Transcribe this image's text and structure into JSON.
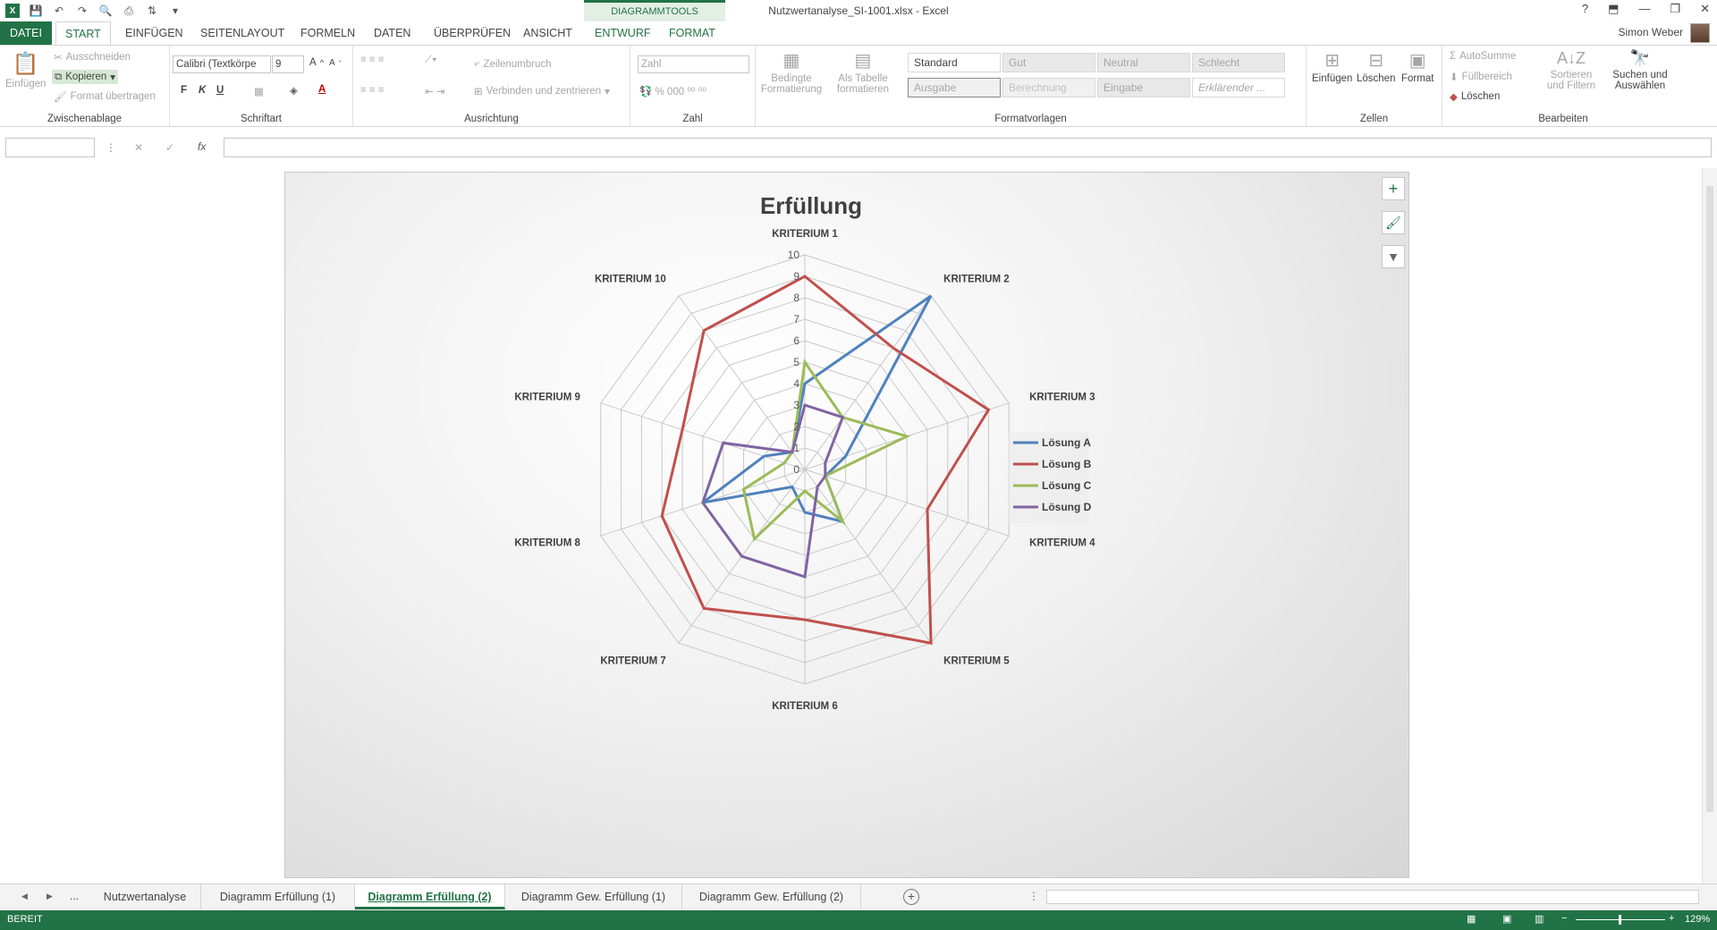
{
  "window": {
    "title": "Nutzwertanalyse_SI-1001.xlsx - Excel",
    "context_group": "DIAGRAMMTOOLS",
    "user": "Simon Weber",
    "help": "?",
    "min": "—",
    "restore": "❐",
    "close": "✕"
  },
  "tabs": {
    "datei": "DATEI",
    "start": "START",
    "einfuegen": "EINFÜGEN",
    "seitenlayout": "SEITENLAYOUT",
    "formeln": "FORMELN",
    "daten": "DATEN",
    "ueberpruefen": "ÜBERPRÜFEN",
    "ansicht": "ANSICHT",
    "entwurf": "ENTWURF",
    "format": "FORMAT"
  },
  "ribbon": {
    "clipboard": {
      "paste": "Einfügen",
      "cut": "Ausschneiden",
      "copy": "Kopieren",
      "format_painter": "Format übertragen",
      "label": "Zwischenablage"
    },
    "font": {
      "name": "Calibri (Textkörpe",
      "size": "9",
      "bold": "F",
      "italic": "K",
      "underline": "U",
      "label": "Schriftart"
    },
    "alignment": {
      "wrap": "Zeilenumbruch",
      "merge": "Verbinden und zentrieren",
      "label": "Ausrichtung"
    },
    "number": {
      "format": "Zahl",
      "label": "Zahl"
    },
    "styles": {
      "conditional": "Bedingte Formatierung",
      "as_table": "Als Tabelle formatieren",
      "cells": [
        "Standard",
        "Gut",
        "Neutral",
        "Schlecht",
        "Ausgabe",
        "Berechnung",
        "Eingabe",
        "Erklärender ..."
      ],
      "label": "Formatvorlagen"
    },
    "cells": {
      "insert": "Einfügen",
      "delete": "Löschen",
      "format": "Format",
      "label": "Zellen"
    },
    "editing": {
      "autosum": "AutoSumme",
      "fill": "Füllbereich",
      "clear": "Löschen",
      "sort": "Sortieren und Filtern",
      "find": "Suchen und Auswählen",
      "label": "Bearbeiten"
    }
  },
  "formula_bar": {
    "cancel": "✕",
    "enter": "✓",
    "fx": "fx",
    "value": ""
  },
  "chart_data": {
    "type": "radar",
    "title": "Erfüllung",
    "categories": [
      "KRITERIUM 1",
      "KRITERIUM 2",
      "KRITERIUM 3",
      "KRITERIUM 4",
      "KRITERIUM 5",
      "KRITERIUM 6",
      "KRITERIUM 7",
      "KRITERIUM 8",
      "KRITERIUM 9",
      "KRITERIUM 10"
    ],
    "rmax": 10,
    "ticks": [
      0,
      1,
      2,
      3,
      4,
      5,
      6,
      7,
      8,
      9,
      10
    ],
    "legend_position": "right",
    "series": [
      {
        "name": "Lösung A",
        "color": "#4f81bd",
        "values": [
          4,
          10,
          2,
          1,
          3,
          2,
          1,
          5,
          2,
          1
        ]
      },
      {
        "name": "Lösung B",
        "color": "#c0504d",
        "values": [
          9,
          7,
          9,
          6,
          10,
          7,
          8,
          7,
          6,
          8
        ]
      },
      {
        "name": "Lösung C",
        "color": "#9bbb59",
        "values": [
          5,
          3,
          5,
          1,
          3,
          1,
          4,
          3,
          1,
          1
        ]
      },
      {
        "name": "Lösung D",
        "color": "#8064a2",
        "values": [
          3,
          3,
          1,
          1,
          1,
          5,
          5,
          5,
          4,
          1
        ]
      }
    ]
  },
  "sheet_tabs": {
    "nav_prev": "◀",
    "nav_next": "▶",
    "more": "...",
    "tabs": [
      "Nutzwertanalyse",
      "Diagramm Erfüllung (1)",
      "Diagramm Erfüllung (2)",
      "Diagramm Gew. Erfüllung (1)",
      "Diagramm Gew. Erfüllung (2)"
    ],
    "add": "+"
  },
  "status": {
    "mode": "BEREIT",
    "zoom": "129%"
  }
}
